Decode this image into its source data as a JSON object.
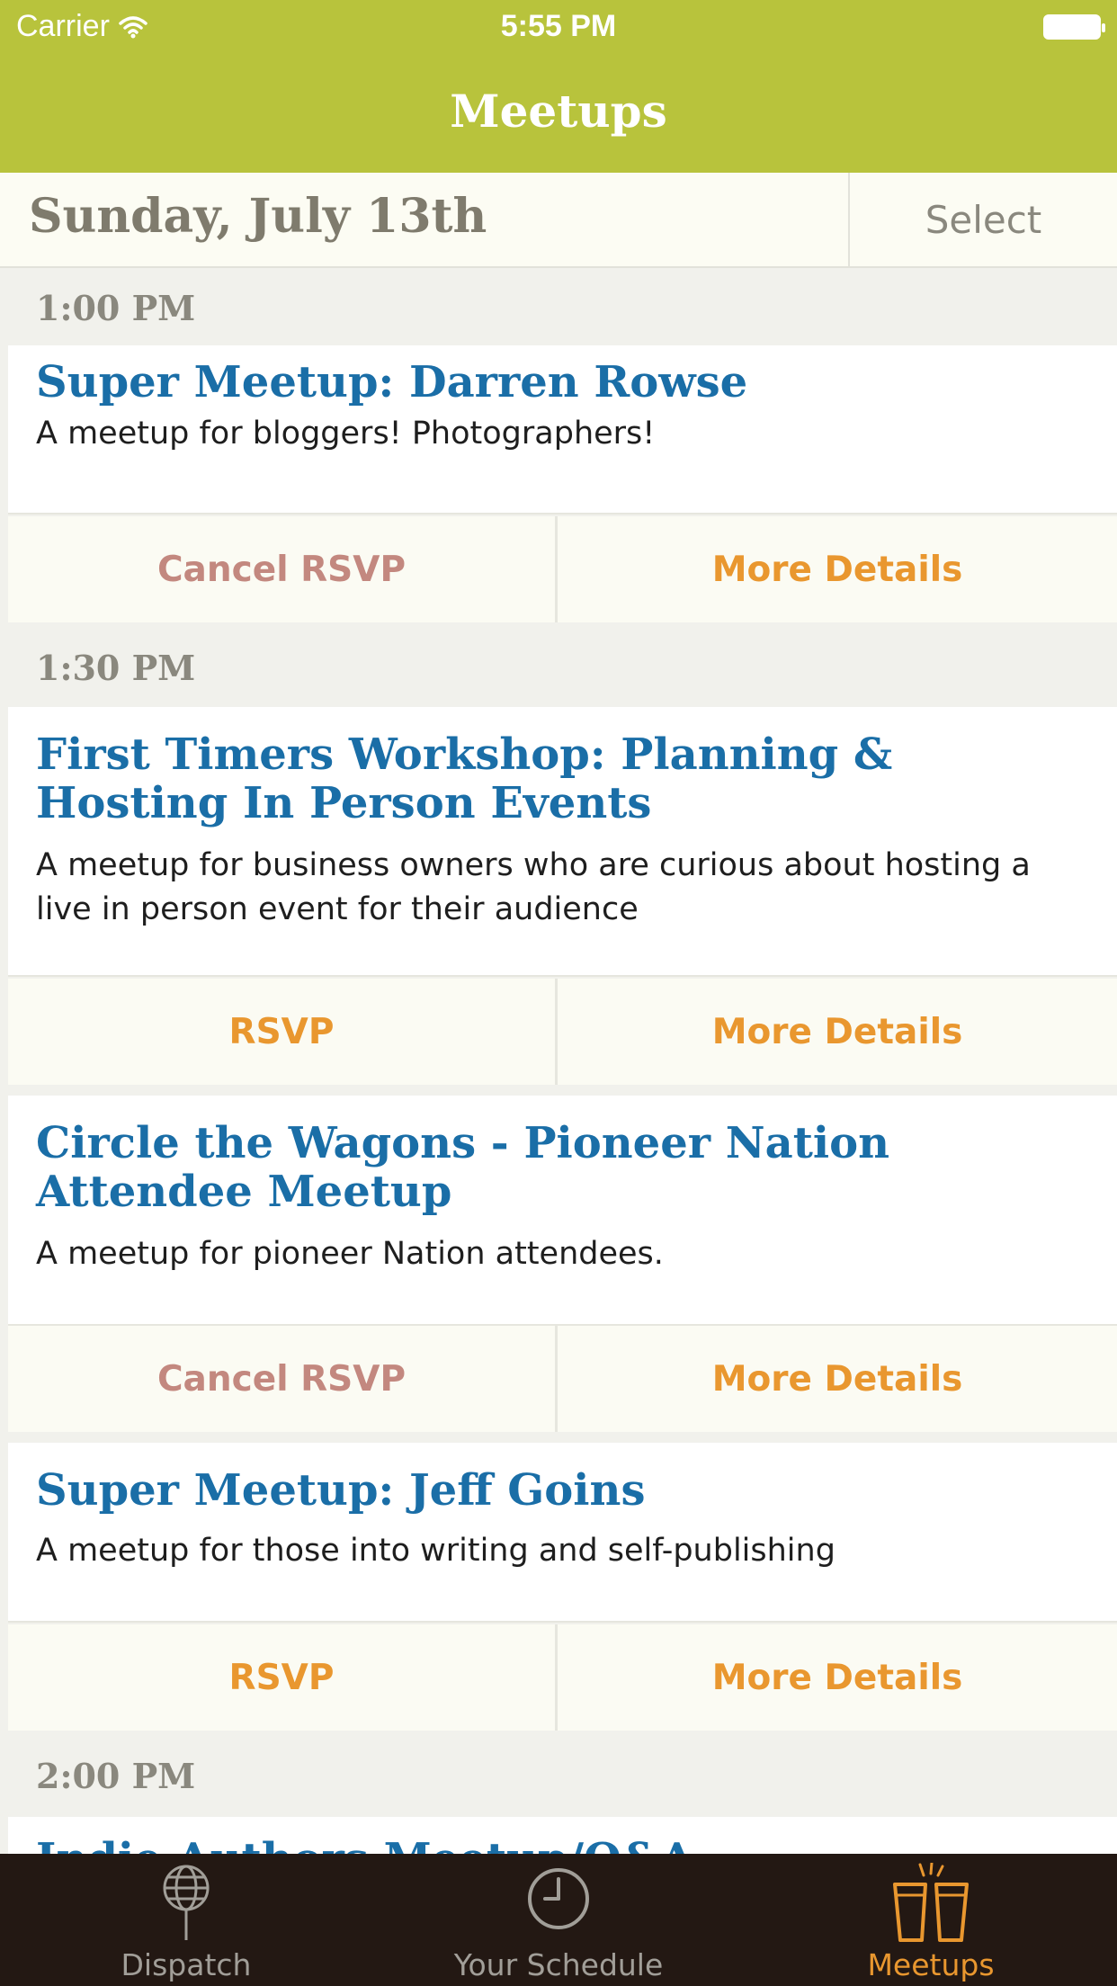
{
  "status_bar": {
    "carrier": "Carrier",
    "time": "5:55 PM"
  },
  "nav": {
    "title": "Meetups"
  },
  "date_bar": {
    "date": "Sunday, July 13th",
    "select_label": "Select"
  },
  "sections": [
    {
      "time": "1:00 PM"
    },
    {
      "time": "1:30 PM"
    },
    {
      "time": "2:00 PM"
    }
  ],
  "meetups": [
    {
      "title": "Super Meetup: Darren Rowse",
      "description": "A meetup for bloggers! Photographers!",
      "rsvp_label": "Cancel RSVP",
      "details_label": "More Details"
    },
    {
      "title": "First Timers Workshop:  Planning & Hosting In Person Events",
      "description": "A meetup for business owners who are curious about hosting a live in person event for their audience",
      "rsvp_label": "RSVP",
      "details_label": "More Details"
    },
    {
      "title": "Circle the Wagons - Pioneer Nation Attendee Meetup",
      "description": "A meetup for pioneer Nation attendees.",
      "rsvp_label": "Cancel RSVP",
      "details_label": "More Details"
    },
    {
      "title": "Super Meetup: Jeff Goins",
      "description": "A meetup for those into writing and self-publishing",
      "rsvp_label": "RSVP",
      "details_label": "More Details"
    },
    {
      "title": "Indie Authors Meetup/Q&A"
    }
  ],
  "tabs": [
    {
      "label": "Dispatch",
      "icon": "globe-icon"
    },
    {
      "label": "Your Schedule",
      "icon": "clock-icon"
    },
    {
      "label": "Meetups",
      "icon": "drinks-icon"
    }
  ],
  "colors": {
    "header": "#b8c33c",
    "title_blue": "#1a6ea7",
    "accent_orange": "#e9972f",
    "cancel_rose": "#c3887f",
    "tab_bar": "#231813"
  }
}
